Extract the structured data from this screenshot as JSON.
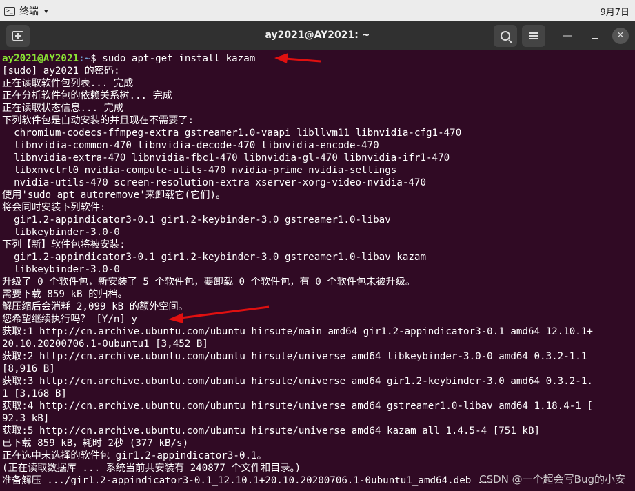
{
  "topbar": {
    "app_name": "终端",
    "date": "9月7日"
  },
  "window": {
    "title": "ay2021@AY2021: ~"
  },
  "prompt": {
    "user_host": "ay2021@AY2021",
    "path": ":~",
    "symbol": "$ ",
    "command": "sudo apt-get install kazam"
  },
  "terminal_lines": [
    "[sudo] ay2021 的密码:",
    "正在读取软件包列表... 完成",
    "正在分析软件包的依赖关系树... 完成",
    "正在读取状态信息... 完成",
    "下列软件包是自动安装的并且现在不需要了:",
    "  chromium-codecs-ffmpeg-extra gstreamer1.0-vaapi libllvm11 libnvidia-cfg1-470",
    "  libnvidia-common-470 libnvidia-decode-470 libnvidia-encode-470",
    "  libnvidia-extra-470 libnvidia-fbc1-470 libnvidia-gl-470 libnvidia-ifr1-470",
    "  libxnvctrl0 nvidia-compute-utils-470 nvidia-prime nvidia-settings",
    "  nvidia-utils-470 screen-resolution-extra xserver-xorg-video-nvidia-470",
    "使用'sudo apt autoremove'来卸载它(它们)。",
    "将会同时安装下列软件:",
    "  gir1.2-appindicator3-0.1 gir1.2-keybinder-3.0 gstreamer1.0-libav",
    "  libkeybinder-3.0-0",
    "下列【新】软件包将被安装:",
    "  gir1.2-appindicator3-0.1 gir1.2-keybinder-3.0 gstreamer1.0-libav kazam",
    "  libkeybinder-3.0-0",
    "升级了 0 个软件包，新安装了 5 个软件包，要卸载 0 个软件包，有 0 个软件包未被升级。",
    "需要下载 859 kB 的归档。",
    "解压缩后会消耗 2,099 kB 的额外空间。",
    "您希望继续执行吗？ [Y/n] y",
    "获取:1 http://cn.archive.ubuntu.com/ubuntu hirsute/main amd64 gir1.2-appindicator3-0.1 amd64 12.10.1+",
    "20.10.20200706.1-0ubuntu1 [3,452 B]",
    "获取:2 http://cn.archive.ubuntu.com/ubuntu hirsute/universe amd64 libkeybinder-3.0-0 amd64 0.3.2-1.1",
    "[8,916 B]",
    "获取:3 http://cn.archive.ubuntu.com/ubuntu hirsute/universe amd64 gir1.2-keybinder-3.0 amd64 0.3.2-1.",
    "1 [3,168 B]",
    "获取:4 http://cn.archive.ubuntu.com/ubuntu hirsute/universe amd64 gstreamer1.0-libav amd64 1.18.4-1 [",
    "92.3 kB]",
    "获取:5 http://cn.archive.ubuntu.com/ubuntu hirsute/universe amd64 kazam all 1.4.5-4 [751 kB]",
    "已下载 859 kB，耗时 2秒 (377 kB/s)",
    "正在选中未选择的软件包 gir1.2-appindicator3-0.1。",
    "(正在读取数据库 ... 系统当前共安装有 240877 个文件和目录。)",
    "准备解压 .../gir1.2-appindicator3-0.1_12.10.1+20.10.20200706.1-0ubuntu1_amd64.deb ..."
  ],
  "watermark": "CSDN @一个超会写Bug的小安",
  "colors": {
    "terminal_bg": "#300a24",
    "prompt_user": "#8ae234",
    "prompt_path": "#729fcf",
    "annotation_arrow": "#e01010"
  },
  "icons": {
    "new_tab": "new-tab-icon",
    "search": "search-icon",
    "menu": "hamburger-menu-icon",
    "minimize": "minimize-icon",
    "maximize": "maximize-icon",
    "close": "close-icon"
  }
}
